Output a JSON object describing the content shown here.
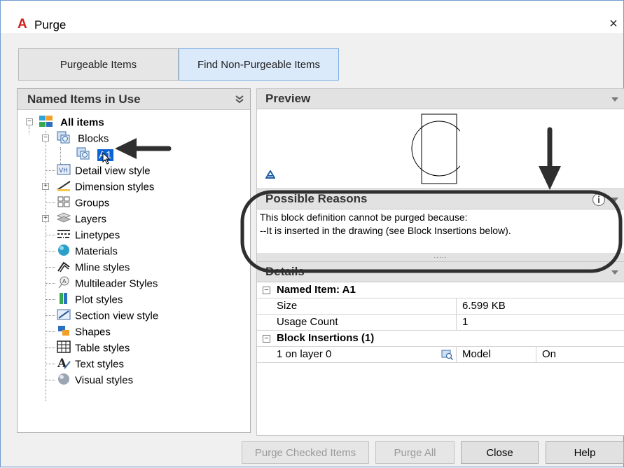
{
  "window": {
    "title": "Purge",
    "app_icon": "A",
    "close_glyph": "×"
  },
  "tabs": [
    {
      "label": "Purgeable Items",
      "active": false
    },
    {
      "label": "Find Non-Purgeable Items",
      "active": true
    }
  ],
  "left_panel": {
    "header": "Named Items in Use",
    "collapse_glyph": "»",
    "tree": {
      "root": "All items",
      "blocks": "Blocks",
      "block_child": "A1",
      "items": [
        "Detail view style",
        "Dimension styles",
        "Groups",
        "Layers",
        "Linetypes",
        "Materials",
        "Mline styles",
        "Multileader Styles",
        "Plot styles",
        "Section view style",
        "Shapes",
        "Table styles",
        "Text styles",
        "Visual styles"
      ]
    }
  },
  "preview": {
    "header": "Preview"
  },
  "reasons": {
    "header": "Possible Reasons",
    "line1": "This block definition cannot be purged because:",
    "line2": "--It is inserted in the drawing (see Block Insertions below).",
    "grip": "....."
  },
  "details": {
    "header": "Details",
    "named_item_section": "Named Item: A1",
    "size_label": "Size",
    "size_value": "6.599 KB",
    "usage_label": "Usage Count",
    "usage_value": "1",
    "insertions_section": "Block Insertions (1)",
    "insertion_row": {
      "name": "1 on layer 0",
      "space": "Model",
      "state": "On"
    }
  },
  "buttons": {
    "purge_checked": "Purge Checked Items",
    "purge_all": "Purge All",
    "close": "Close",
    "help": "Help"
  },
  "colors": {
    "annotation": "#2f2f2f",
    "selection": "#0a64d6",
    "active_tab": "#dbeafb"
  }
}
